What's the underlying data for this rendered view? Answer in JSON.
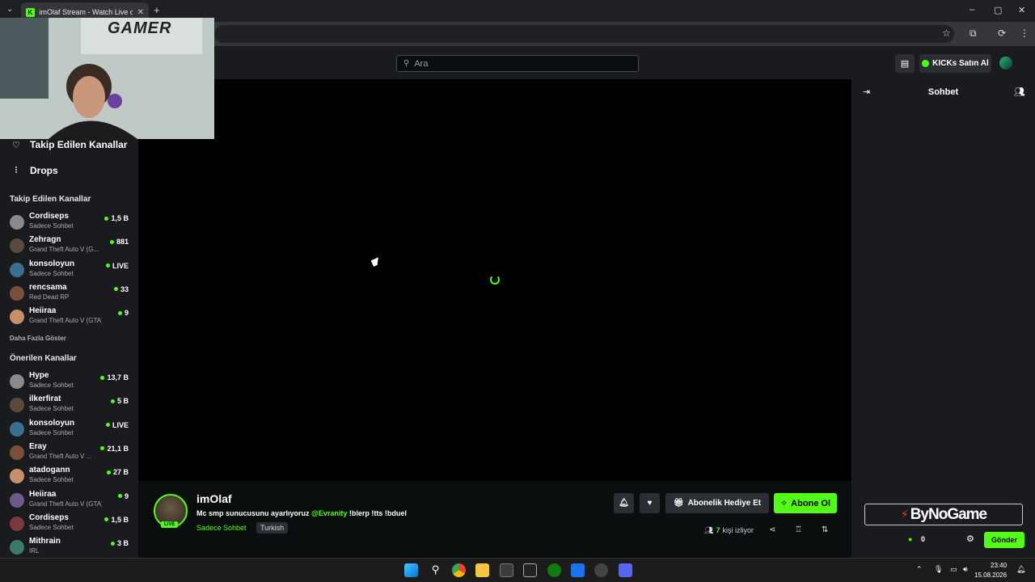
{
  "browser": {
    "tab_title": "imOlaf Stream - Watch Live on",
    "new_tab": "+",
    "close": "✕"
  },
  "header": {
    "search_placeholder": "Ara",
    "kicks_button": "KICKs Satın Al"
  },
  "sidebar": {
    "nav": [
      {
        "label": "Takip Edilen Kanallar",
        "icon": "heart-icon"
      },
      {
        "label": "Drops",
        "icon": "drops-icon"
      }
    ],
    "followed_title": "Takip Edilen Kanallar",
    "followed": [
      {
        "name": "Cordiseps",
        "sub": "Sadece Sohbet",
        "viewers": "1,5 B"
      },
      {
        "name": "Zehragn",
        "sub": "Grand Theft Auto V (G...",
        "viewers": "881"
      },
      {
        "name": "konsoloyun",
        "sub": "Sadece Sohbet",
        "viewers": "LIVE"
      },
      {
        "name": "rencsama",
        "sub": "Red Dead RP",
        "viewers": "33"
      },
      {
        "name": "Heiiraa",
        "sub": "Grand Theft Auto V (GTA)",
        "viewers": "9"
      }
    ],
    "show_more": "Daha Fazla Göster",
    "recommended_title": "Önerilen Kanallar",
    "recommended": [
      {
        "name": "Hype",
        "sub": "Sadece Sohbet",
        "viewers": "13,7 B"
      },
      {
        "name": "ilkerfirat",
        "sub": "Sadece Sohbet",
        "viewers": "5 B"
      },
      {
        "name": "konsoloyun",
        "sub": "Sadece Sohbet",
        "viewers": "LIVE"
      },
      {
        "name": "Eray",
        "sub": "Grand Theft Auto V ...",
        "viewers": "21,1 B"
      },
      {
        "name": "atadogann",
        "sub": "Sadece Sohbet",
        "viewers": "27 B"
      },
      {
        "name": "Heiiraa",
        "sub": "Grand Theft Auto V (GTA)",
        "viewers": "9"
      },
      {
        "name": "Cordiseps",
        "sub": "Sadece Sohbet",
        "viewers": "1,5 B"
      },
      {
        "name": "Mithrain",
        "sub": "IRL",
        "viewers": "3 B"
      }
    ]
  },
  "webcam": {
    "overlay_text": "GAMER"
  },
  "stream": {
    "channel_name": "imOlaf",
    "live_badge": "LIVE",
    "title_prefix": "Mc smp sunucusunu ayarlıyoruz",
    "title_mention": "@Evranity",
    "title_suffix": "!blerp !tts !bduel",
    "category": "Sadece Sohbet",
    "language": "Turkish",
    "gift_button": "Abonelik Hediye Et",
    "subscribe_button": "Abone Ol",
    "viewer_count": "7",
    "viewer_label": "kişi izliyor"
  },
  "chat": {
    "title": "Sohbet",
    "banner": "ByNoGame",
    "points": "0",
    "send_button": "Gönder"
  },
  "taskbar": {
    "time": "23:40",
    "date": "15.08.2026"
  }
}
